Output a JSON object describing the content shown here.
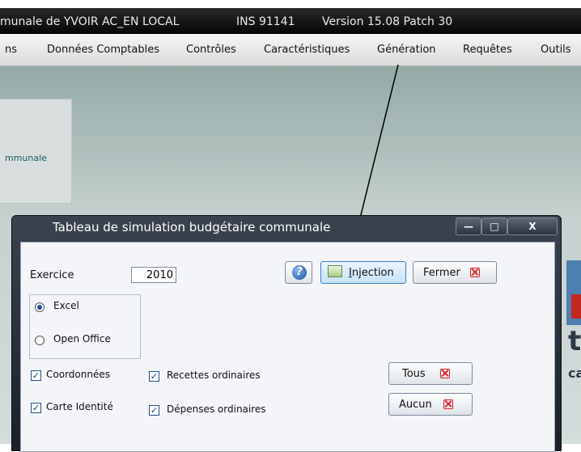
{
  "titlebar": {
    "app_title": "munale de  YVOIR AC_EN LOCAL",
    "ins": "INS 91141",
    "version": "Version 15.08 Patch 30"
  },
  "menu": {
    "items": [
      "ns",
      "Données Comptables",
      "Contrôles",
      "Caractéristiques",
      "Génération",
      "Requêtes",
      "Outils"
    ]
  },
  "workspace": {
    "panel_text": "mmunale",
    "side_text_large": "te",
    "side_text_small": "ca"
  },
  "dialog": {
    "title": "Tableau de simulation budgétaire communale",
    "exercice_label": "Exercice",
    "exercice_value": "2010",
    "radio_excel": "Excel",
    "radio_open_office": "Open Office",
    "cb_coordonnees": "Coordonnées",
    "cb_carte_identite": "Carte Identité",
    "cb_recettes": "Recettes ordinaires",
    "cb_depenses": "Dépenses ordinaires",
    "btn_injection_first": "I",
    "btn_injection_rest": "njection",
    "btn_fermer": "Fermer",
    "btn_tous": "Tous",
    "btn_aucun": "Aucun",
    "help_glyph": "?",
    "checkmark": "✓",
    "ctrl_minimize": "—",
    "ctrl_maximize": "□",
    "ctrl_close": "X"
  }
}
